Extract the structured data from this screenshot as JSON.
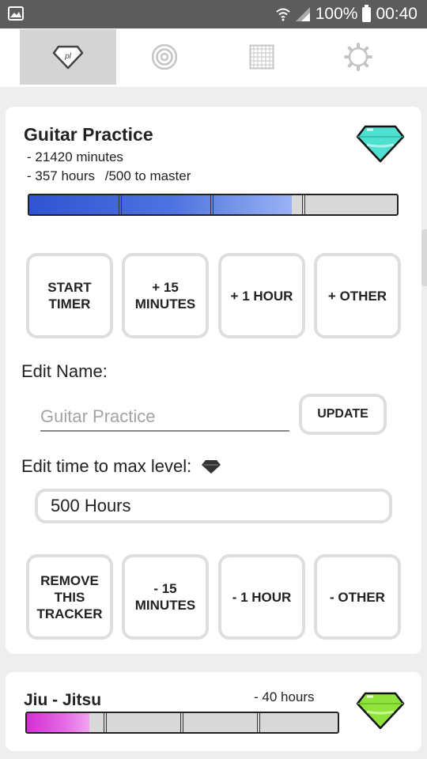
{
  "status_bar": {
    "battery_percent": "100%",
    "time": "00:40",
    "icons": [
      "image-icon",
      "wifi-icon",
      "signal-icon",
      "battery-icon"
    ]
  },
  "tabs": [
    {
      "name": "trackers",
      "icon": "gem-logo-icon",
      "selected": true
    },
    {
      "name": "goals",
      "icon": "target-icon",
      "selected": false
    },
    {
      "name": "calendar",
      "icon": "grid-icon",
      "selected": false
    },
    {
      "name": "settings",
      "icon": "gear-icon",
      "selected": false
    }
  ],
  "tracker": {
    "title": "Guitar Practice",
    "minutes_text": "- 21420 minutes",
    "hours_text": "- 357 hours",
    "goal_text": "/500 to master",
    "progress_fraction": 0.714,
    "gem_color": "#4fe0cf",
    "actions_add": [
      {
        "label": "START\nTIMER"
      },
      {
        "label": "+ 15\nMINUTES"
      },
      {
        "label": "+ 1 HOUR"
      },
      {
        "label": "+ OTHER"
      }
    ],
    "edit_name_label": "Edit Name:",
    "name_placeholder": "Guitar Practice",
    "update_label": "UPDATE",
    "edit_time_label": "Edit time to max level:",
    "max_hours_value": "500 Hours",
    "actions_remove": [
      {
        "label": "REMOVE\nTHIS\nTRACKER"
      },
      {
        "label": "- 15\nMINUTES"
      },
      {
        "label": "- 1 HOUR"
      },
      {
        "label": "- OTHER"
      }
    ]
  },
  "next_tracker": {
    "title": "Jiu - Jitsu",
    "hours_text": "- 40 hours",
    "progress_fraction": 0.2,
    "gem_color": "#8fe33a"
  },
  "colors": {
    "accent_blue": "#3a5fd6",
    "magenta": "#d63ad6",
    "button_border": "#dedede"
  }
}
